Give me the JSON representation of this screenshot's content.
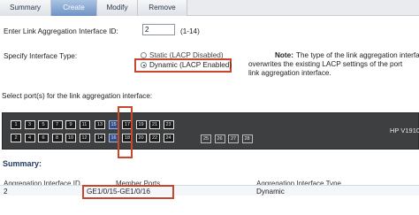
{
  "tabs": [
    {
      "label": "Summary",
      "active": false
    },
    {
      "label": "Create",
      "active": true
    },
    {
      "label": "Modify",
      "active": false
    },
    {
      "label": "Remove",
      "active": false
    }
  ],
  "form": {
    "interface_id_label": "Enter Link Aggregation Interface ID:",
    "interface_id_value": "2",
    "interface_id_range": "(1-14)",
    "type_label": "Specify Interface Type:",
    "static_option": "Static (LACP Disabled)",
    "dynamic_option": "Dynamic (LACP Enabled)",
    "selected_type": "dynamic",
    "note_title": "Note:",
    "note_line1": "The type of the link aggregation interface",
    "note_line2": "overwrites the existing LACP settings of the port",
    "note_line3": "link aggregation interface."
  },
  "ports_section": {
    "label": "Select port(s) for the link aggregation interface:",
    "device_name": "HP V1910",
    "top_row": [
      "1",
      "3",
      "5",
      "7",
      "9",
      "11",
      "13",
      "15",
      "17",
      "19",
      "21",
      "23"
    ],
    "bottom_row": [
      "2",
      "4",
      "6",
      "8",
      "10",
      "12",
      "14",
      "16",
      "18",
      "20",
      "22",
      "24"
    ],
    "extra_ports": [
      "25",
      "26",
      "27",
      "28"
    ],
    "selected": [
      "15",
      "16"
    ]
  },
  "summary": {
    "heading": "Summary:",
    "columns": [
      "Aggregation Interface ID",
      "Member Ports",
      "Aggregation Interface Type"
    ],
    "rows": [
      {
        "id": "2",
        "members": "GE1/0/15-GE1/0/16",
        "type": "Dynamic"
      }
    ]
  },
  "colors": {
    "highlight": "#c9462a",
    "active_tab": "#6e93c4",
    "switch_body": "#3d3f41"
  }
}
